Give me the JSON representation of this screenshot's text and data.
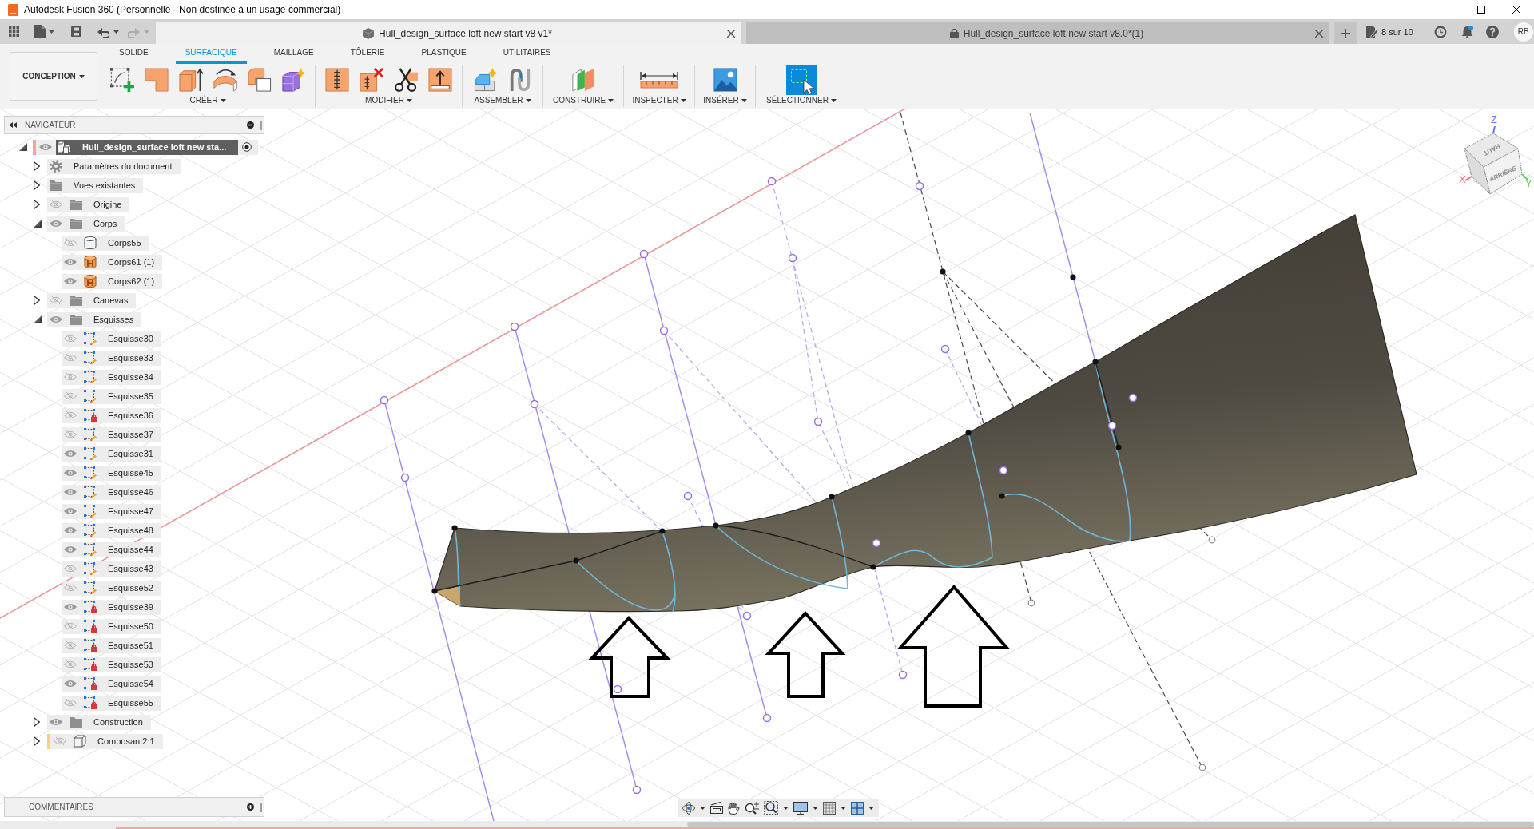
{
  "window": {
    "title": "Autodesk Fusion 360 (Personnelle - Non destinée à un usage commercial)"
  },
  "history_buttons": [
    {
      "kind": "undo",
      "disabled": false
    },
    {
      "kind": "redo",
      "disabled": true
    }
  ],
  "document_tabs": [
    {
      "title": "Hull_design_surface loft new start v8 v1*",
      "selected": true,
      "locked": false
    },
    {
      "title": "Hull_design_surface loft new start v8.0*(1)",
      "selected": false,
      "locked": true
    }
  ],
  "job_status": {
    "label": "8 sur 10"
  },
  "notifications": {
    "unread": true
  },
  "user": {
    "initials": "RB"
  },
  "workspace": {
    "label": "CONCEPTION"
  },
  "toolbar_tabs": [
    {
      "label": "SOLIDE",
      "selected": false
    },
    {
      "label": "SURFACIQUE",
      "selected": true
    },
    {
      "label": "MAILLAGE",
      "selected": false
    },
    {
      "label": "TÔLERIE",
      "selected": false
    },
    {
      "label": "PLASTIQUE",
      "selected": false
    },
    {
      "label": "UTILITAIRES",
      "selected": false
    }
  ],
  "tool_groups": [
    {
      "label": "CRÉER"
    },
    {
      "label": "MODIFIER"
    },
    {
      "label": "ASSEMBLER"
    },
    {
      "label": "CONSTRUIRE"
    },
    {
      "label": "INSPECTER"
    },
    {
      "label": "INSÉRER"
    },
    {
      "label": "SÉLECTIONNER"
    }
  ],
  "navigator": {
    "title": "NAVIGATEUR",
    "tree": [
      {
        "label": "Hull_design_surface loft new sta...",
        "kind": "assembly",
        "visible": true,
        "expanded": true,
        "active": true,
        "color": "#f4a3a3",
        "children": [
          {
            "label": "Paramètres du document",
            "kind": "settings",
            "expanded": false
          },
          {
            "label": "Vues existantes",
            "kind": "folder",
            "expanded": false
          },
          {
            "label": "Origine",
            "kind": "folder",
            "visible": false,
            "expanded": false
          },
          {
            "label": "Corps",
            "kind": "folder",
            "visible": true,
            "expanded": true,
            "children": [
              {
                "label": "Corps55",
                "kind": "solid",
                "visible": false
              },
              {
                "label": "Corps61 (1)",
                "kind": "surface",
                "visible": true
              },
              {
                "label": "Corps62 (1)",
                "kind": "surface",
                "visible": true
              }
            ]
          },
          {
            "label": "Canevas",
            "kind": "folder",
            "visible": false,
            "expanded": false
          },
          {
            "label": "Esquisses",
            "kind": "folder",
            "visible": true,
            "expanded": true,
            "children": [
              {
                "label": "Esquisse30",
                "kind": "sketch",
                "visible": false
              },
              {
                "label": "Esquisse33",
                "kind": "sketch",
                "visible": false
              },
              {
                "label": "Esquisse34",
                "kind": "sketch",
                "visible": false
              },
              {
                "label": "Esquisse35",
                "kind": "sketch",
                "visible": false
              },
              {
                "label": "Esquisse36",
                "kind": "locked",
                "visible": false
              },
              {
                "label": "Esquisse37",
                "kind": "sketch",
                "visible": false
              },
              {
                "label": "Esquisse31",
                "kind": "sketch",
                "visible": true
              },
              {
                "label": "Esquisse45",
                "kind": "sketch",
                "visible": true
              },
              {
                "label": "Esquisse46",
                "kind": "sketch",
                "visible": true
              },
              {
                "label": "Esquisse47",
                "kind": "sketch",
                "visible": true
              },
              {
                "label": "Esquisse48",
                "kind": "sketch",
                "visible": true
              },
              {
                "label": "Esquisse44",
                "kind": "sketch",
                "visible": true
              },
              {
                "label": "Esquisse43",
                "kind": "sketch",
                "visible": false
              },
              {
                "label": "Esquisse52",
                "kind": "sketch",
                "visible": false
              },
              {
                "label": "Esquisse39",
                "kind": "locked",
                "visible": true
              },
              {
                "label": "Esquisse50",
                "kind": "locked",
                "visible": false
              },
              {
                "label": "Esquisse51",
                "kind": "locked",
                "visible": false
              },
              {
                "label": "Esquisse53",
                "kind": "locked",
                "visible": false
              },
              {
                "label": "Esquisse54",
                "kind": "locked",
                "visible": true
              },
              {
                "label": "Esquisse55",
                "kind": "locked",
                "visible": false
              }
            ]
          },
          {
            "label": "Construction",
            "kind": "folder",
            "visible": true,
            "expanded": false
          },
          {
            "label": "Composant2:1",
            "kind": "component",
            "visible": false,
            "expanded": false,
            "color": "#f7d27a"
          }
        ]
      }
    ]
  },
  "comments": {
    "title": "COMMENTAIRES"
  },
  "view_cube": {
    "top_face": "HAUT",
    "front_face": "ARRIÈRE",
    "axes": [
      {
        "label": "X",
        "color": "#f26a6a"
      },
      {
        "label": "Y",
        "color": "#5fd35f"
      },
      {
        "label": "Z",
        "color": "#6a78f2"
      }
    ]
  }
}
